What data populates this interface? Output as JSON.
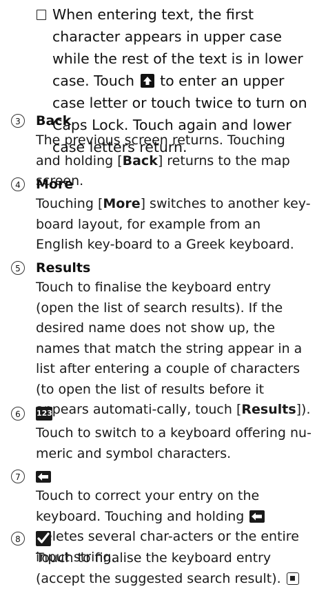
{
  "note": {
    "line1_pre": "When entering text, the first character appears in upper case while the rest of the text is in lower case. Touch",
    "line1_post": "to enter an upper case letter or touch twice to turn on Caps Lock. Touch again and lower case letters return.",
    "shift_icon": "shift-up-arrow-icon"
  },
  "items": [
    {
      "number": "3",
      "title": "Back",
      "text_a": "The previous screen returns. Touching and holding [",
      "bold_a": "Back",
      "text_b": "] returns to the map screen."
    },
    {
      "number": "4",
      "title": "More",
      "text_a": "Touching [",
      "bold_a": "More",
      "text_b": "] switches to another key-board layout, for example from an English key-board to a Greek keyboard."
    },
    {
      "number": "5",
      "title": "Results",
      "text_a": "Touch to finalise the keyboard entry (open the list of search results). If the desired name does not show up, the names that match the string appear in a list after entering a couple of characters (to open the list of results before it appears automati-cally, touch [",
      "bold_a": "Results",
      "text_b": "])."
    },
    {
      "number": "6",
      "icon": "numeric-keyboard-icon",
      "icon_text": "123",
      "text": "Touch to switch to a keyboard offering nu-meric and symbol characters."
    },
    {
      "number": "7",
      "icon": "backspace-icon",
      "text_a": "Touch to correct your entry on the keyboard. Touching and holding",
      "text_b": "deletes several char-acters or the entire input string."
    },
    {
      "number": "8",
      "icon": "checkmark-icon",
      "text": "Touch to finalise the keyboard entry (accept the suggested search result).",
      "end_icon": "end-of-section-icon"
    }
  ]
}
